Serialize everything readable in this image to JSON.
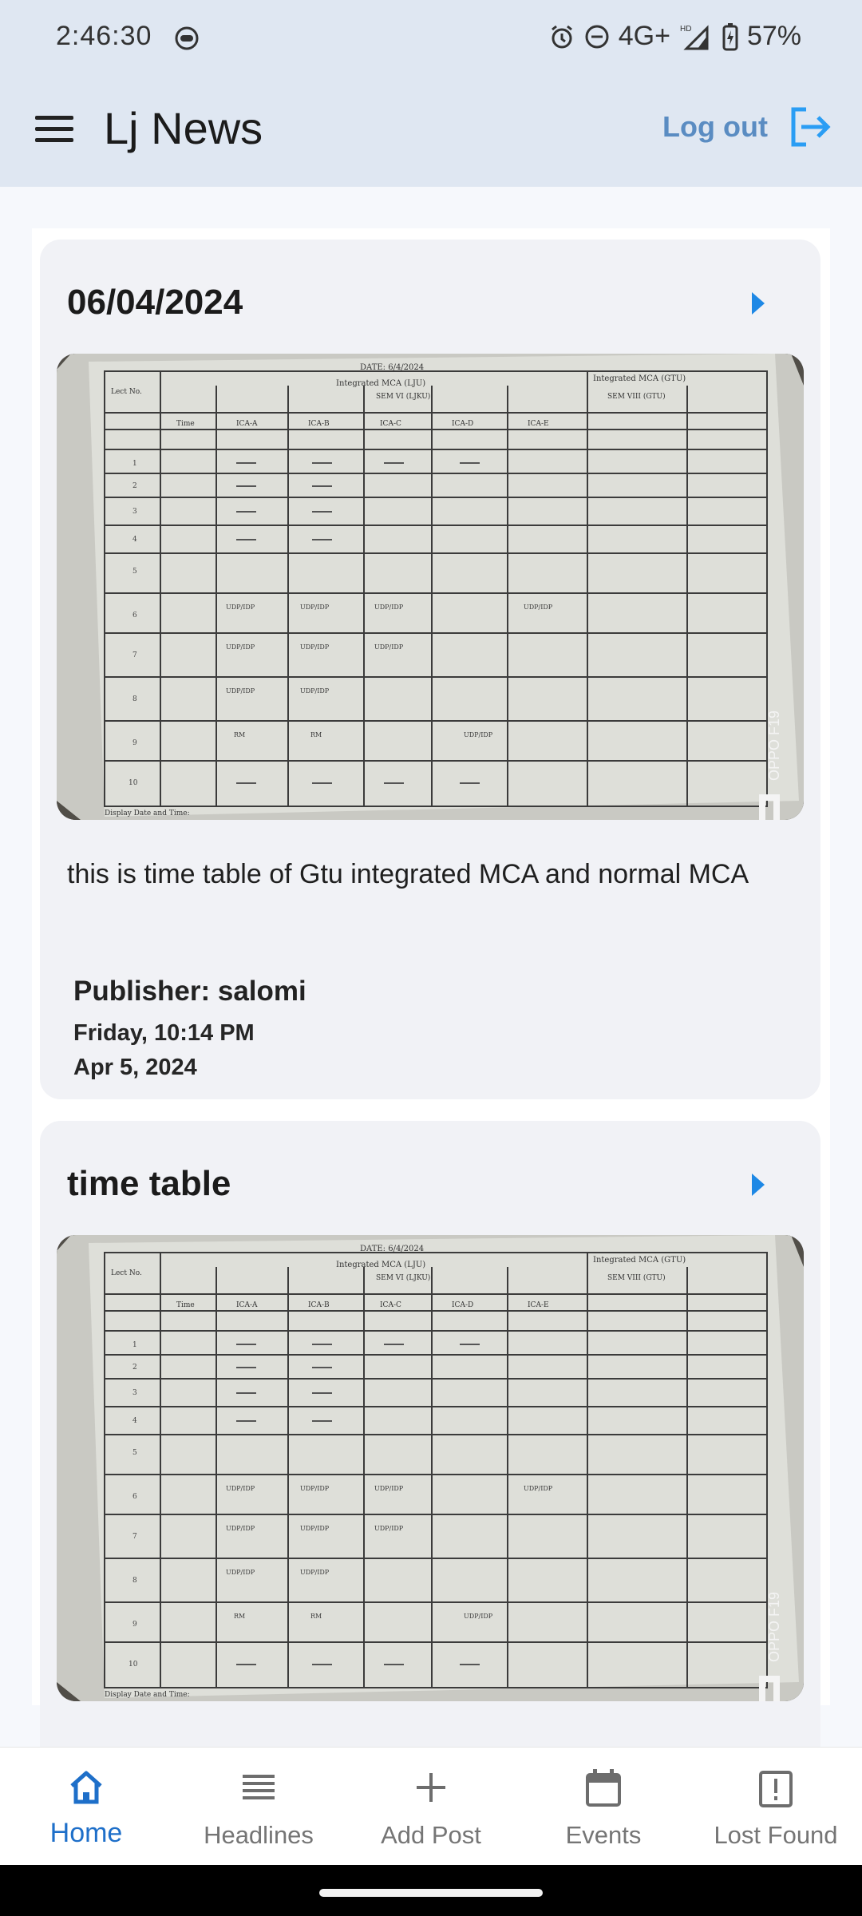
{
  "status_bar": {
    "time": "2:46:30",
    "network": "4G+",
    "signal_label": "HD",
    "battery": "57%"
  },
  "app_bar": {
    "title": "Lj News",
    "logout_label": "Log out",
    "menu_icon": "hamburger-menu-icon",
    "logout_icon": "logout-icon"
  },
  "posts": [
    {
      "title": "06/04/2024",
      "description": "this is time table of Gtu integrated MCA and normal MCA",
      "publisher": "Publisher: salomi",
      "day_time": "Friday, 10:14 PM",
      "date": "Apr 5, 2024",
      "image": {
        "header_left": "Integrated MCA (LJU)",
        "header_right": "Integrated MCA (GTU)",
        "date_text": "DATE: 6/4/2024",
        "sem_mid": "SEM VI (LJKU)",
        "sem_right": "SEM VIII (GTU)",
        "columns": [
          "Lect No.",
          "Time",
          "ICA-A",
          "ICA-B",
          "ICA-C",
          "ICA-D",
          "ICA-E"
        ],
        "footer": "Display Date and Time:",
        "watermark": "OPPO F19"
      }
    },
    {
      "title": "time table",
      "image": {
        "header_left": "Integrated MCA (LJU)",
        "header_right": "Integrated MCA (GTU)",
        "date_text": "DATE: 6/4/2024",
        "sem_mid": "SEM VI (LJKU)",
        "sem_right": "SEM VIII (GTU)",
        "columns": [
          "Lect No.",
          "Time",
          "ICA-A",
          "ICA-B",
          "ICA-C",
          "ICA-D",
          "ICA-E"
        ],
        "footer": "Display Date and Time:",
        "watermark": "OPPO F19"
      }
    }
  ],
  "bottom_nav": [
    {
      "label": "Home",
      "icon": "home-icon",
      "active": true
    },
    {
      "label": "Headlines",
      "icon": "list-icon",
      "active": false
    },
    {
      "label": "Add Post",
      "icon": "plus-icon",
      "active": false
    },
    {
      "label": "Events",
      "icon": "calendar-icon",
      "active": false
    },
    {
      "label": "Lost Found",
      "icon": "clipboard-alert-icon",
      "active": false
    }
  ],
  "colors": {
    "accent": "#1e6fc9",
    "logout": "#5a8cc2",
    "app_bar_bg": "#dfe7f2"
  }
}
